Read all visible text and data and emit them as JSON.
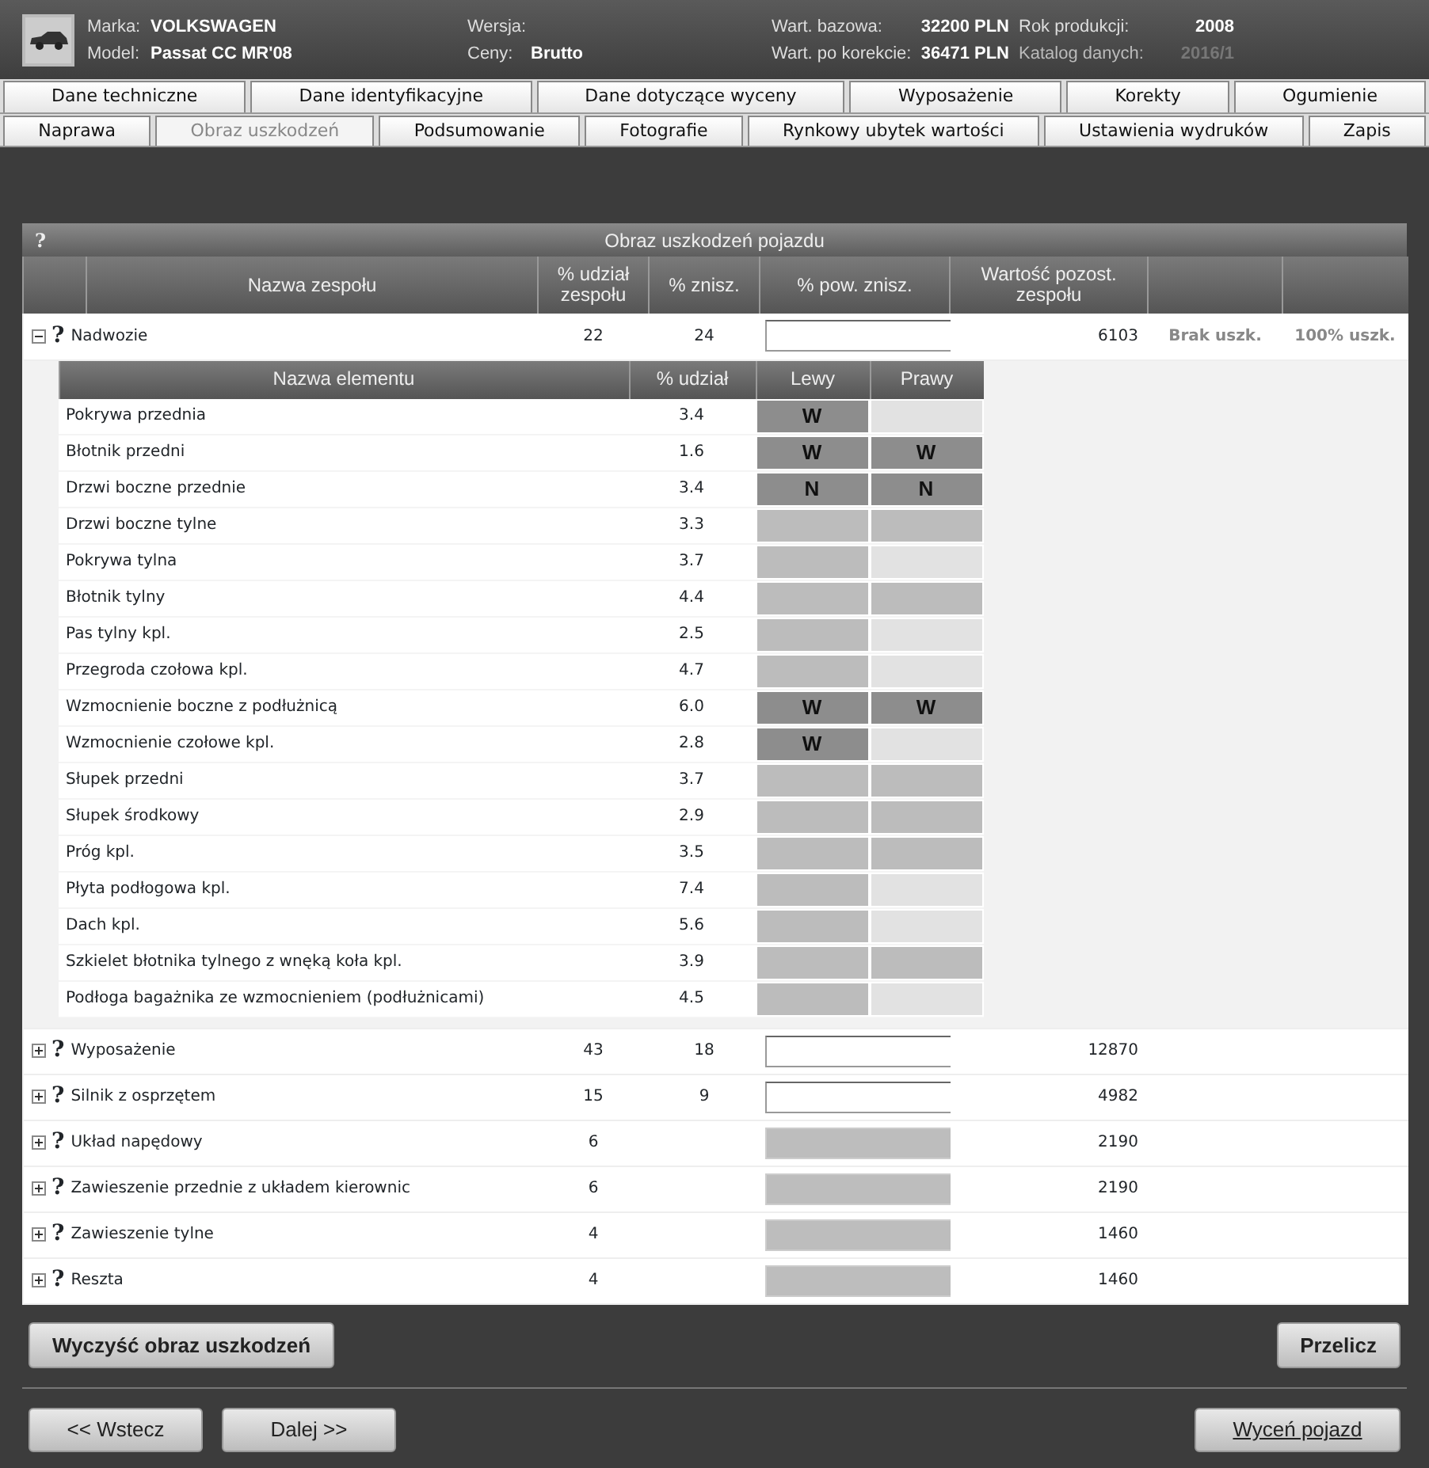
{
  "header": {
    "fields": [
      {
        "label": "Marka:",
        "value": "VOLKSWAGEN",
        "dimmed": false
      },
      {
        "label": "Model:",
        "value": "Passat CC MR'08",
        "dimmed": false
      },
      {
        "label": "Wersja:",
        "dimmed": false
      },
      {
        "label": "Ceny:",
        "value": "Brutto",
        "dimmed": false
      },
      {
        "label": "Wart. bazowa:",
        "value": "32200 PLN",
        "dimmed": false
      },
      {
        "label": "Wart. po korekcie:",
        "value": "36471 PLN",
        "dimmed": false
      },
      {
        "label": "Rok produkcji:",
        "value": "2008",
        "dimmed": false
      },
      {
        "label": "Katalog danych:",
        "value": "2016/1",
        "dimmed": true
      }
    ]
  },
  "tabs": [
    [
      {
        "label": "Dane techniczne",
        "selected": false
      },
      {
        "label": "Dane identyfikacyjne",
        "selected": false
      },
      {
        "label": "Dane dotyczące wyceny",
        "selected": false
      },
      {
        "label": "Wyposażenie",
        "selected": false
      },
      {
        "label": "Korekty",
        "selected": false
      },
      {
        "label": "Ogumienie",
        "selected": false
      }
    ],
    [
      {
        "label": "Naprawa",
        "selected": false
      },
      {
        "label": "Obraz uszkodzeń",
        "selected": true
      },
      {
        "label": "Podsumowanie",
        "selected": false
      },
      {
        "label": "Fotografie",
        "selected": false
      },
      {
        "label": "Rynkowy ubytek wartości",
        "selected": false
      },
      {
        "label": "Ustawienia wydruków",
        "selected": false
      },
      {
        "label": "Zapis",
        "selected": false
      }
    ]
  ],
  "panel": {
    "help": "?",
    "title": "Obraz uszkodzeń pojazdu",
    "columns": [
      "Nazwa zespołu",
      "% udział zespołu",
      "% znisz.",
      "% pow. znisz.",
      "Wartość pozost. zespołu"
    ],
    "element_columns": [
      "Nazwa elementu",
      "% udział",
      "Lewy",
      "Prawy"
    ],
    "groups": [
      {
        "expanded": true,
        "help": "?",
        "name": "Nadwozie",
        "share": "22",
        "damage": "24",
        "field_disabled": false,
        "value": "6103",
        "actions": [
          "Brak uszk.",
          "100% uszk."
        ],
        "elements": [
          {
            "name": "Pokrywa przednia",
            "share": "3.4",
            "left": {
              "kind": "mark",
              "text": "W"
            },
            "right": {
              "kind": "blank"
            }
          },
          {
            "name": "Błotnik przedni",
            "share": "1.6",
            "left": {
              "kind": "mark",
              "text": "W"
            },
            "right": {
              "kind": "mark",
              "text": "W"
            }
          },
          {
            "name": "Drzwi boczne przednie",
            "share": "3.4",
            "left": {
              "kind": "mark",
              "text": "N"
            },
            "right": {
              "kind": "mark",
              "text": "N"
            }
          },
          {
            "name": "Drzwi boczne tylne",
            "share": "3.3",
            "left": {
              "kind": "open"
            },
            "right": {
              "kind": "open"
            }
          },
          {
            "name": "Pokrywa tylna",
            "share": "3.7",
            "left": {
              "kind": "open"
            },
            "right": {
              "kind": "blank"
            }
          },
          {
            "name": "Błotnik tylny",
            "share": "4.4",
            "left": {
              "kind": "open"
            },
            "right": {
              "kind": "open"
            }
          },
          {
            "name": "Pas tylny kpl.",
            "share": "2.5",
            "left": {
              "kind": "open"
            },
            "right": {
              "kind": "blank"
            }
          },
          {
            "name": "Przegroda czołowa kpl.",
            "share": "4.7",
            "left": {
              "kind": "open"
            },
            "right": {
              "kind": "blank"
            }
          },
          {
            "name": "Wzmocnienie boczne z podłużnicą",
            "share": "6.0",
            "left": {
              "kind": "mark",
              "text": "W"
            },
            "right": {
              "kind": "mark",
              "text": "W"
            }
          },
          {
            "name": "Wzmocnienie czołowe kpl.",
            "share": "2.8",
            "left": {
              "kind": "mark",
              "text": "W"
            },
            "right": {
              "kind": "blank"
            }
          },
          {
            "name": "Słupek przedni",
            "share": "3.7",
            "left": {
              "kind": "open"
            },
            "right": {
              "kind": "open"
            }
          },
          {
            "name": "Słupek środkowy",
            "share": "2.9",
            "left": {
              "kind": "open"
            },
            "right": {
              "kind": "open"
            }
          },
          {
            "name": "Próg kpl.",
            "share": "3.5",
            "left": {
              "kind": "open"
            },
            "right": {
              "kind": "open"
            }
          },
          {
            "name": "Płyta podłogowa kpl.",
            "share": "7.4",
            "left": {
              "kind": "open"
            },
            "right": {
              "kind": "blank"
            }
          },
          {
            "name": "Dach kpl.",
            "share": "5.6",
            "left": {
              "kind": "open"
            },
            "right": {
              "kind": "blank"
            }
          },
          {
            "name": "Szkielet błotnika tylnego z wnęką koła kpl.",
            "share": "3.9",
            "left": {
              "kind": "open"
            },
            "right": {
              "kind": "open"
            }
          },
          {
            "name": "Podłoga bagażnika ze wzmocnieniem (podłużnicami)",
            "share": "4.5",
            "left": {
              "kind": "open"
            },
            "right": {
              "kind": "blank"
            }
          }
        ]
      },
      {
        "expanded": false,
        "help": "?",
        "name": "Wyposażenie",
        "share": "43",
        "damage": "18",
        "field_disabled": false,
        "value": "12870"
      },
      {
        "expanded": false,
        "help": "?",
        "name": "Silnik z osprzętem",
        "share": "15",
        "damage": "9",
        "field_disabled": false,
        "value": "4982"
      },
      {
        "expanded": false,
        "help": "?",
        "name": "Układ napędowy",
        "share": "6",
        "field_disabled": true,
        "value": "2190"
      },
      {
        "expanded": false,
        "help": "?",
        "name": "Zawieszenie przednie z układem kierownic",
        "share": "6",
        "field_disabled": true,
        "value": "2190"
      },
      {
        "expanded": false,
        "help": "?",
        "name": "Zawieszenie tylne",
        "share": "4",
        "field_disabled": true,
        "value": "1460"
      },
      {
        "expanded": false,
        "help": "?",
        "name": "Reszta",
        "share": "4",
        "field_disabled": true,
        "value": "1460"
      }
    ],
    "buttons": [
      "Wyczyść obraz uszkodzeń",
      "Przelicz"
    ]
  },
  "footer": {
    "buttons": [
      {
        "label": "<< Wstecz",
        "underlined": false
      },
      {
        "label": "Dalej >>",
        "underlined": false
      }
    ],
    "primary": {
      "label": "Wyceń pojazd",
      "underlined": true
    }
  }
}
